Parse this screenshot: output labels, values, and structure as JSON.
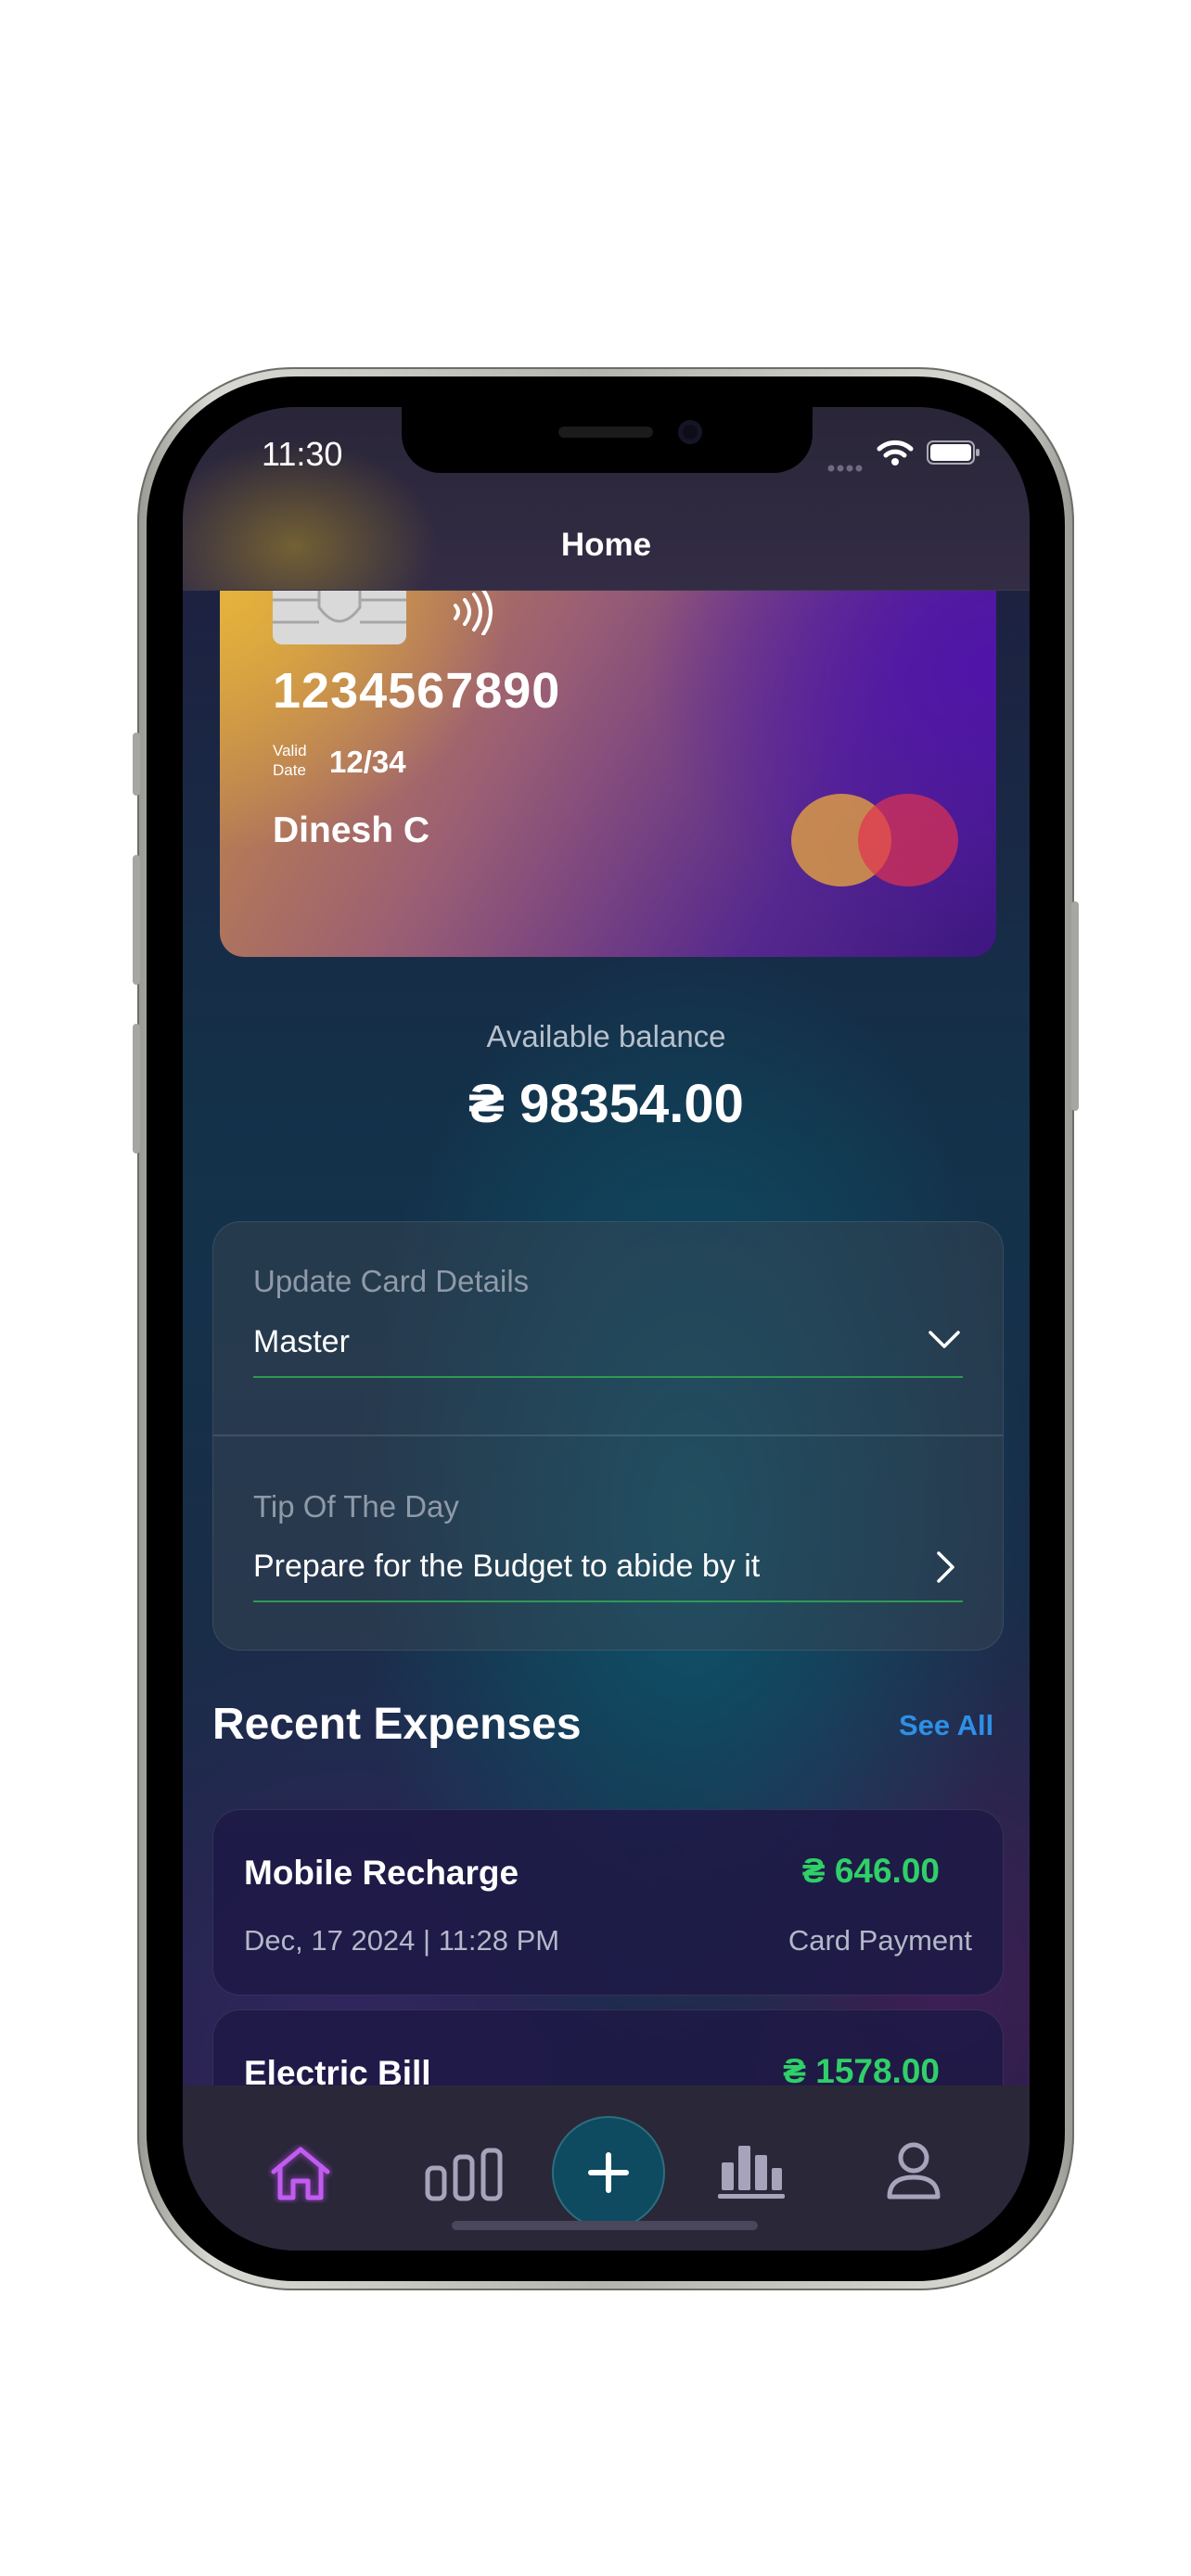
{
  "status_bar": {
    "time": "11:30",
    "signal": "signal-dots-icon",
    "wifi": "wifi-icon",
    "battery": "battery-icon"
  },
  "header": {
    "title": "Home"
  },
  "card": {
    "number": "1234567890",
    "valid_label_line1": "Valid",
    "valid_label_line2": "Date",
    "valid_date": "12/34",
    "holder": "Dinesh C",
    "brand_icon": "mastercard-logo-icon",
    "chip_icon": "card-chip-icon",
    "contactless_icon": "contactless-icon"
  },
  "balance": {
    "label": "Available balance",
    "value": "₴ 98354.00"
  },
  "update_card": {
    "label": "Update Card Details",
    "value": "Master",
    "icon": "chevron-down-icon"
  },
  "tip": {
    "label": "Tip Of The Day",
    "value": "Prepare for the Budget to abide by it",
    "icon": "chevron-right-icon"
  },
  "recent": {
    "title": "Recent Expenses",
    "see_all": "See All",
    "items": [
      {
        "name": "Mobile Recharge",
        "amount": "₴ 646.00",
        "date": "Dec, 17 2024 | 11:28 PM",
        "method": "Card Payment"
      },
      {
        "name": "Electric Bill",
        "amount": "₴ 1578.00"
      }
    ]
  },
  "colors": {
    "accent_green": "#2fd067",
    "link_blue": "#2e8fe6",
    "active_tab": "#b44be3",
    "fab": "#0e4a60"
  },
  "tabs": [
    {
      "icon": "home-icon",
      "active": true
    },
    {
      "icon": "bar-chart-icon",
      "active": false
    },
    {
      "icon": "plus-icon",
      "active": false
    },
    {
      "icon": "stats-icon",
      "active": false
    },
    {
      "icon": "profile-icon",
      "active": false
    }
  ]
}
